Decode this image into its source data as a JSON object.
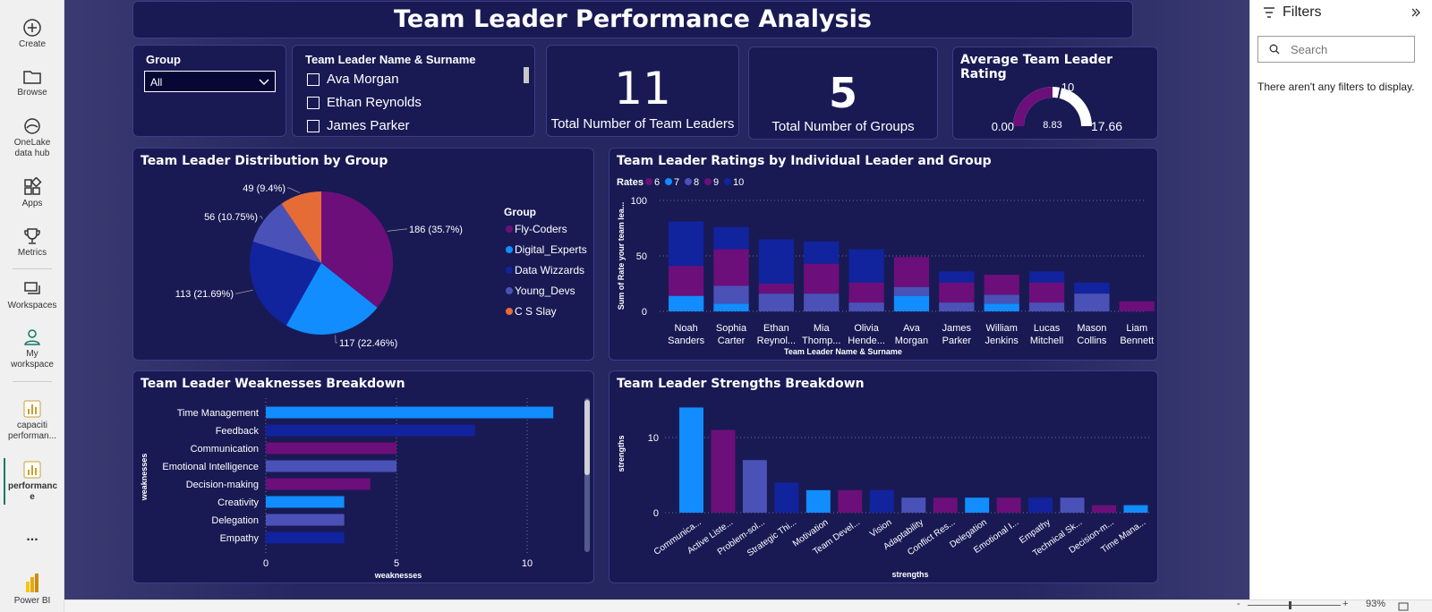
{
  "nav": {
    "items": [
      {
        "label": "Create",
        "icon": "plus-circle-icon"
      },
      {
        "label": "Browse",
        "icon": "folder-icon"
      },
      {
        "label": "OneLake data hub",
        "icon": "onelake-icon"
      },
      {
        "label": "Apps",
        "icon": "apps-icon"
      },
      {
        "label": "Metrics",
        "icon": "trophy-icon"
      },
      {
        "label": "Workspaces",
        "icon": "workspaces-icon"
      },
      {
        "label": "My workspace",
        "icon": "person-icon"
      },
      {
        "label": "capaciti performan...",
        "icon": "report-icon"
      },
      {
        "label": "performanc e",
        "icon": "report-icon"
      },
      {
        "label": "...",
        "icon": "more-icon"
      },
      {
        "label": "Power BI",
        "icon": "powerbi-logo"
      }
    ]
  },
  "dashboard": {
    "title": "Team Leader Performance Analysis",
    "group_slicer": {
      "label": "Group",
      "value": "All"
    },
    "leader_slicer": {
      "label": "Team Leader Name & Surname",
      "options": [
        "Ava Morgan",
        "Ethan Reynolds",
        "James Parker"
      ]
    },
    "kpi_leaders": {
      "value": "11",
      "label": "Total Number of Team Leaders"
    },
    "kpi_groups": {
      "value": "5",
      "label": "Total Number of Groups"
    },
    "gauge": {
      "title": "Average Team Leader Rating",
      "min": "0.00",
      "max": "17.66",
      "target": "10",
      "value": "8.83",
      "value_num": 8.83,
      "max_num": 17.66
    }
  },
  "chart_data": [
    {
      "type": "pie",
      "title": "Team Leader Distribution by Group",
      "legend_title": "Group",
      "legend_position": "right",
      "slices": [
        {
          "name": "Fly-Coders",
          "value": 186,
          "label": "186 (35.7%)",
          "color": "#6c0f7a"
        },
        {
          "name": "Digital_Experts",
          "value": 117,
          "label": "117 (22.46%)",
          "color": "#118dff"
        },
        {
          "name": "Data Wizzards",
          "value": 113,
          "label": "113 (21.69%)",
          "color": "#12239e"
        },
        {
          "name": "Young_Devs",
          "value": 56,
          "label": "56 (10.75%)",
          "color": "#4a52b8"
        },
        {
          "name": "C S Slay",
          "value": 49,
          "label": "49 (9.4%)",
          "color": "#e66c37"
        }
      ]
    },
    {
      "type": "bar",
      "stacked": true,
      "title": "Team Leader Ratings by Individual Leader and Group",
      "legend_title": "Rates",
      "legend_position": "top-left",
      "xlabel": "Team Leader Name & Surname",
      "ylabel": "Sum of Rate your team lea...",
      "ylim": [
        0,
        100
      ],
      "yticks": [
        0,
        50,
        100
      ],
      "categories": [
        "Noah Sanders",
        "Sophia Carter",
        "Ethan Reynol...",
        "Mia Thomp...",
        "Olivia Hende...",
        "Ava Morgan",
        "James Parker",
        "William Jenkins",
        "Lucas Mitchell",
        "Mason Collins",
        "Liam Bennett"
      ],
      "series": [
        {
          "name": "6",
          "color": "#6c0f7a",
          "values": [
            0,
            0,
            0,
            0,
            0,
            0,
            0,
            0,
            0,
            0,
            0
          ]
        },
        {
          "name": "7",
          "color": "#118dff",
          "values": [
            14,
            7,
            0,
            0,
            0,
            14,
            0,
            7,
            0,
            0,
            0
          ]
        },
        {
          "name": "8",
          "color": "#4a52b8",
          "values": [
            0,
            16,
            16,
            16,
            8,
            8,
            8,
            8,
            8,
            16,
            0
          ]
        },
        {
          "name": "9",
          "color": "#6c0f7a",
          "values": [
            27,
            33,
            9,
            27,
            18,
            27,
            18,
            18,
            18,
            0,
            9
          ]
        },
        {
          "name": "10",
          "color": "#12239e",
          "values": [
            40,
            20,
            40,
            20,
            30,
            0,
            10,
            0,
            10,
            10,
            0
          ]
        }
      ]
    },
    {
      "type": "bar",
      "orientation": "horizontal",
      "title": "Team Leader Weaknesses Breakdown",
      "xlabel": "weaknesses",
      "ylabel": "weaknesses",
      "xlim": [
        0,
        12
      ],
      "xticks": [
        0,
        5,
        10
      ],
      "categories": [
        "Time Management",
        "Feedback",
        "Communication",
        "Emotional Intelligence",
        "Decision-making",
        "Creativity",
        "Delegation",
        "Empathy"
      ],
      "values": [
        11,
        8,
        5,
        5,
        4,
        3,
        3,
        3
      ],
      "colors": [
        "#118dff",
        "#12239e",
        "#6c0f7a",
        "#4a52b8",
        "#6c0f7a",
        "#118dff",
        "#4a52b8",
        "#12239e"
      ]
    },
    {
      "type": "bar",
      "title": "Team Leader Strengths Breakdown",
      "xlabel": "strengths",
      "ylabel": "strengths",
      "ylim": [
        0,
        14
      ],
      "yticks": [
        0,
        10
      ],
      "categories": [
        "Communica...",
        "Active Liste...",
        "Problem-sol...",
        "Strategic Thi...",
        "Motivation",
        "Team Devel...",
        "Vision",
        "Adaptability",
        "Conflict Res...",
        "Delegation",
        "Emotional I...",
        "Empathy",
        "Technical Sk...",
        "Decision-m...",
        "Time Mana..."
      ],
      "values": [
        14,
        11,
        7,
        4,
        3,
        3,
        3,
        2,
        2,
        2,
        2,
        2,
        2,
        1,
        1
      ],
      "colors": [
        "#118dff",
        "#6c0f7a",
        "#4a52b8",
        "#12239e",
        "#118dff",
        "#6c0f7a",
        "#12239e",
        "#4a52b8",
        "#6c0f7a",
        "#118dff",
        "#6c0f7a",
        "#12239e",
        "#4a52b8",
        "#6c0f7a",
        "#118dff"
      ]
    }
  ],
  "filters": {
    "title": "Filters",
    "search_placeholder": "Search",
    "empty_text": "There aren't any filters to display."
  },
  "status": {
    "zoom": "93%",
    "minus": "-",
    "plus": "+"
  }
}
